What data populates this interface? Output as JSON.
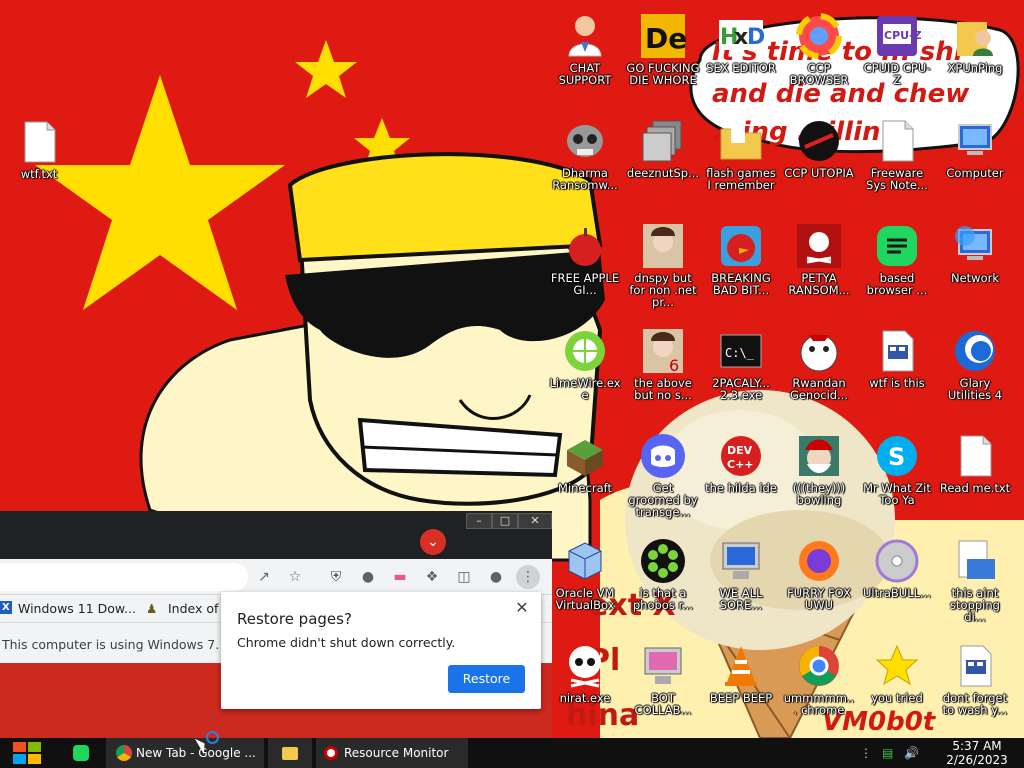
{
  "wallpaper": {
    "bubble_text_lines": [
      "It's time to ... shi",
      "and die and chew",
      "...ing ...illin"
    ],
    "watermark": "VM0b0t",
    "side_text": [
      "ext X",
      "Pl",
      "hina"
    ]
  },
  "desktop_icons": [
    {
      "label": "wtf.txt",
      "icon": "text-file-icon"
    },
    {
      "label": "CHAT SUPPORT",
      "icon": "doctor-icon"
    },
    {
      "label": "GO FUCKING DIE WHORE",
      "icon": "de-icon"
    },
    {
      "label": "SEX EDITOR",
      "icon": "hxd-icon"
    },
    {
      "label": "CCP BROWSER",
      "icon": "ccp-browser-icon"
    },
    {
      "label": "CPUID CPU-Z",
      "icon": "cpuz-icon"
    },
    {
      "label": "XPUnPing",
      "icon": "user-folder-icon"
    },
    {
      "label": "Dharma Ransomw...",
      "icon": "skull-helmet-icon"
    },
    {
      "label": "deeznutSp...",
      "icon": "file-stack-icon"
    },
    {
      "label": "flash games I remember",
      "icon": "folder-icon"
    },
    {
      "label": "CCP UTOPIA",
      "icon": "utopia-icon"
    },
    {
      "label": "Freeware Sys Note...",
      "icon": "blank-file-icon"
    },
    {
      "label": "Computer",
      "icon": "computer-icon"
    },
    {
      "label": "FREE APPLE GI...",
      "icon": "apple-icon"
    },
    {
      "label": "dnspy but for non .net pr...",
      "icon": "portrait-icon"
    },
    {
      "label": "BREAKING BAD BIT...",
      "icon": "angry-bird-icon"
    },
    {
      "label": "PETYA RANSOM...",
      "icon": "petya-skull-icon"
    },
    {
      "label": "based browser ...",
      "icon": "chat-app-icon"
    },
    {
      "label": "Network",
      "icon": "network-icon"
    },
    {
      "label": "LimeWire.exe",
      "icon": "limewire-icon"
    },
    {
      "label": "the above but no s...",
      "icon": "portrait6-icon"
    },
    {
      "label": "2PACALY... 2.3.exe",
      "icon": "console-icon"
    },
    {
      "label": "Rwandan Genocid...",
      "icon": "meme-face-icon"
    },
    {
      "label": "wtf is this",
      "icon": "ini-file-icon"
    },
    {
      "label": "Glary Utilities 4",
      "icon": "glary-icon"
    },
    {
      "label": "Minecraft",
      "icon": "minecraft-icon"
    },
    {
      "label": "Get groomed by transge...",
      "icon": "discord-icon"
    },
    {
      "label": "the hilda ide",
      "icon": "devcpp-icon"
    },
    {
      "label": "(((they))) bowling",
      "icon": "santa-icon"
    },
    {
      "label": "Mr What Zit Too Ya",
      "icon": "skype-icon"
    },
    {
      "label": "Read me.txt",
      "icon": "text-file-icon"
    },
    {
      "label": "Oracle VM VirtualBox",
      "icon": "virtualbox-icon"
    },
    {
      "label": "is that a phobos r...",
      "icon": "icq-icon"
    },
    {
      "label": "WE ALL SORE...",
      "icon": "pc-icon"
    },
    {
      "label": "FURRY FOX UWU",
      "icon": "firefox-icon"
    },
    {
      "label": "UltraBULL...",
      "icon": "disc-icon"
    },
    {
      "label": "this aint stopping di...",
      "icon": "setup-icon"
    },
    {
      "label": "nirat.exe",
      "icon": "skull-icon"
    },
    {
      "label": "BOT COLLAB...",
      "icon": "monitor-icon"
    },
    {
      "label": "BEEP BEEP",
      "icon": "vlc-icon"
    },
    {
      "label": "ummmmm... chrome",
      "icon": "chrome-icon"
    },
    {
      "label": "you tried",
      "icon": "star-icon"
    },
    {
      "label": "dont forget to wash y...",
      "icon": "ini-file-icon"
    }
  ],
  "chrome": {
    "bookmarks": [
      "Windows 11 Dow...",
      "Index of /"
    ],
    "infobar_text": "This computer is using Windows 7.",
    "dialog": {
      "title": "Restore pages?",
      "message": "Chrome didn't shut down correctly.",
      "button": "Restore"
    }
  },
  "taskbar": {
    "items": [
      {
        "label": "New Tab - Google ...",
        "icon": "chrome-icon"
      },
      {
        "label": "",
        "icon": "folder-icon"
      },
      {
        "label": "Resource Monitor",
        "icon": "resource-monitor-icon"
      }
    ],
    "time": "5:37 AM",
    "date": "2/26/2023"
  }
}
